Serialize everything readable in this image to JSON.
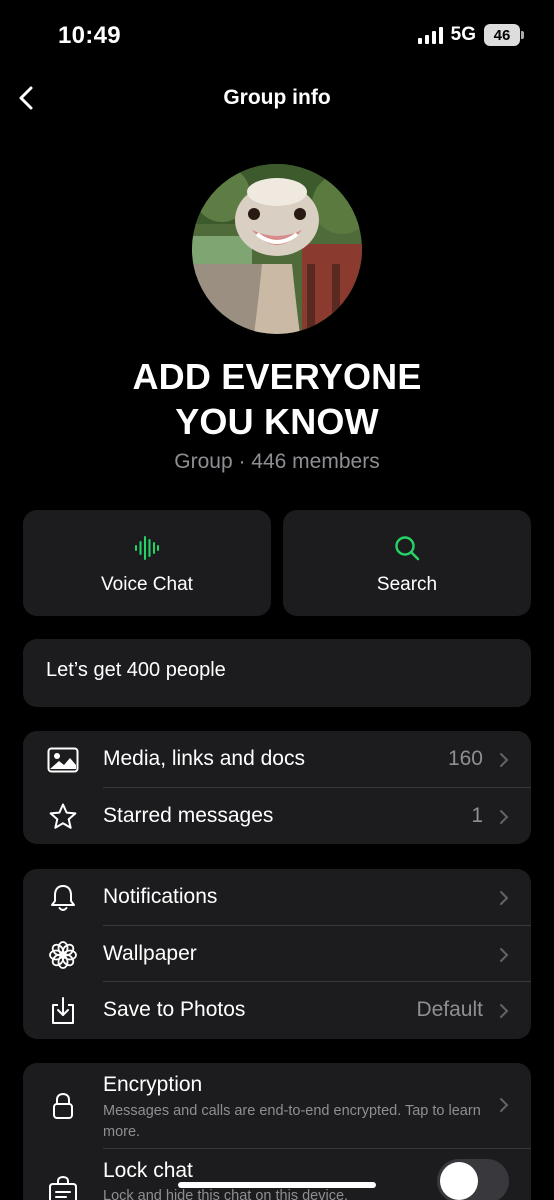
{
  "status_bar": {
    "time": "10:49",
    "network": "5G",
    "battery": "46"
  },
  "nav": {
    "title": "Group info"
  },
  "group": {
    "name_line1": "ADD EVERYONE",
    "name_line2": "YOU KNOW",
    "subtitle": "Group · 446 members"
  },
  "actions": [
    {
      "label": "Voice Chat",
      "icon": "voice-waveform-icon"
    },
    {
      "label": "Search",
      "icon": "search-icon"
    }
  ],
  "description": "Let’s get 400 people",
  "media_section": [
    {
      "label": "Media, links and docs",
      "value": "160",
      "icon": "image-icon"
    },
    {
      "label": "Starred messages",
      "value": "1",
      "icon": "star-icon"
    }
  ],
  "settings_section": [
    {
      "label": "Notifications",
      "value": "",
      "icon": "bell-icon"
    },
    {
      "label": "Wallpaper",
      "value": "",
      "icon": "flower-icon"
    },
    {
      "label": "Save to Photos",
      "value": "Default",
      "icon": "download-icon"
    }
  ],
  "privacy_section": {
    "encryption_label": "Encryption",
    "encryption_sub": "Messages and calls are end-to-end encrypted. Tap to learn more.",
    "lock_label": "Lock chat",
    "lock_sub": "Lock and hide this chat on this device.",
    "lock_enabled": false
  },
  "colors": {
    "background": "#000000",
    "card": "#1c1c1e",
    "accent": "#25d366",
    "secondary_text": "#8e8e93"
  }
}
